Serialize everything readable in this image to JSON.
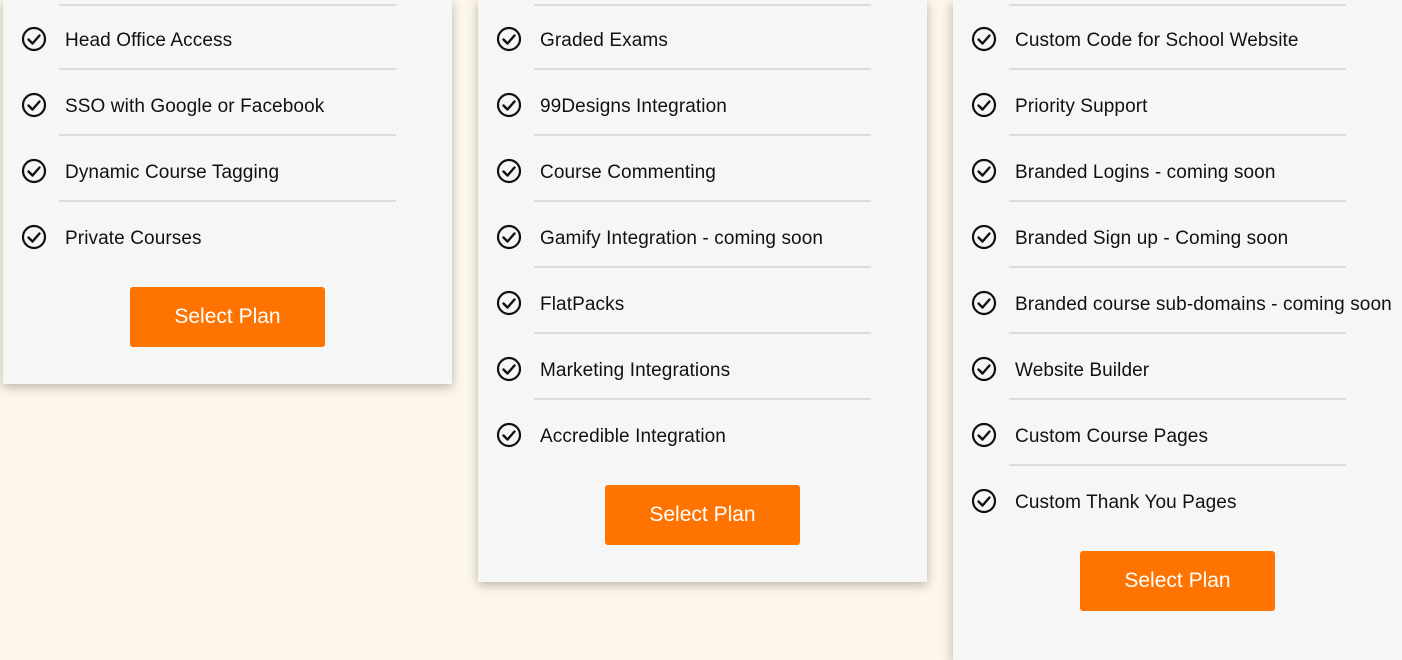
{
  "plans": [
    {
      "features": [
        "Head Office Access",
        "SSO with Google or Facebook",
        "Dynamic Course Tagging",
        "Private Courses"
      ],
      "button_label": "Select Plan"
    },
    {
      "features": [
        "Graded Exams",
        "99Designs Integration",
        "Course Commenting",
        "Gamify Integration - coming soon",
        "FlatPacks",
        "Marketing Integrations",
        "Accredible Integration"
      ],
      "button_label": "Select Plan"
    },
    {
      "features": [
        "Custom Code for School Website",
        "Priority Support",
        "Branded Logins - coming soon",
        "Branded Sign up - Coming soon",
        "Branded course sub-domains - coming soon",
        "Website Builder",
        "Custom Course Pages",
        "Custom Thank You Pages"
      ],
      "button_label": "Select Plan"
    }
  ],
  "icons": {
    "feature_icon": "check-circle-icon"
  },
  "colors": {
    "accent": "#ff7300",
    "card_bg": "#f6f6f6",
    "page_bg": "#fdf6ea",
    "divider": "#dcdcdc"
  }
}
